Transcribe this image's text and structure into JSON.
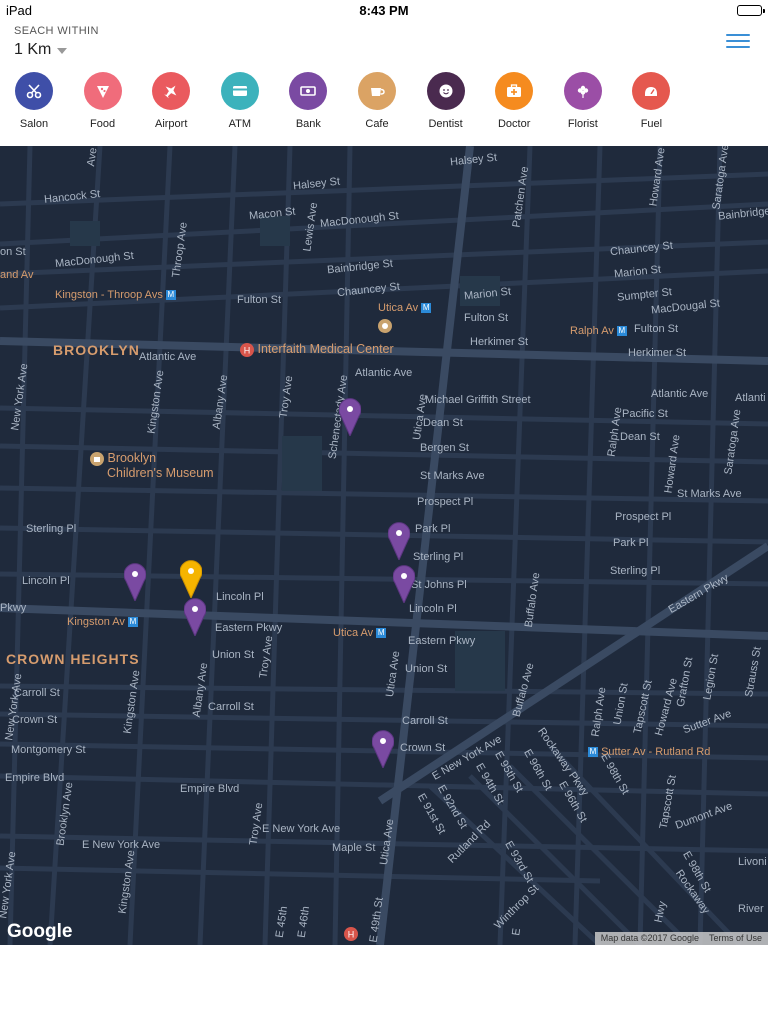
{
  "status_bar": {
    "carrier": "iPad",
    "time": "8:43 PM"
  },
  "search": {
    "label": "SEACH WITHIN",
    "radius": "1 Km"
  },
  "categories": [
    {
      "label": "Salon",
      "color": "#3f4fa8",
      "icon": "scissors-icon"
    },
    {
      "label": "Food",
      "color": "#f06c7b",
      "icon": "pizza-icon"
    },
    {
      "label": "Airport",
      "color": "#ea5a5e",
      "icon": "airplane-icon"
    },
    {
      "label": "ATM",
      "color": "#3cb2bc",
      "icon": "card-icon"
    },
    {
      "label": "Bank",
      "color": "#7a4aa2",
      "icon": "money-icon"
    },
    {
      "label": "Cafe",
      "color": "#dba364",
      "icon": "coffee-icon"
    },
    {
      "label": "Dentist",
      "color": "#4a2a4f",
      "icon": "tooth-icon"
    },
    {
      "label": "Doctor",
      "color": "#f58b1f",
      "icon": "medical-kit-icon"
    },
    {
      "label": "Florist",
      "color": "#9b4ea6",
      "icon": "flower-icon"
    },
    {
      "label": "Fuel",
      "color": "#e5584e",
      "icon": "fuel-icon"
    }
  ],
  "map": {
    "labels": {
      "brooklyn": "BROOKLYN",
      "crown_heights": "CROWN HEIGHTS",
      "interfaith": "Interfaith Medical Center",
      "museum_1": "Brooklyn",
      "museum_2": "Children's Museum",
      "kingston_throop": "Kingston - Throop Avs",
      "utica_av_top": "Utica Av",
      "ralph_av": "Ralph Av",
      "kingston_av": "Kingston Av",
      "utica_av_bottom": "Utica Av",
      "sutter_rutland": "Sutter Av - Rutland Rd",
      "halsey_st_1": "Halsey St",
      "halsey_st_2": "Halsey St",
      "hancock_st": "Hancock St",
      "macon_st": "Macon St",
      "macdonough_st_1": "MacDonough St",
      "macdonough_st_2": "MacDonough St",
      "macdougal_st": "MacDougal St",
      "bainbridge_st_1": "Bainbridge St",
      "bainbridge_st_2": "Bainbridge",
      "chauncey_st_1": "Chauncey St",
      "chauncey_st_2": "Chauncey St",
      "marion_st_1": "Marion St",
      "marion_st_2": "Marion St",
      "sumpter_st": "Sumpter St",
      "fulton_st_1": "Fulton St",
      "fulton_st_2": "Fulton St",
      "fulton_st_3": "Fulton St",
      "herkimer_st_1": "Herkimer St",
      "herkimer_st_2": "Herkimer St",
      "atlantic_ave_1": "Atlantic Ave",
      "atlantic_ave_2": "Atlantic Ave",
      "atlantic_ave_3": "Atlantic Ave",
      "atlantic_trunc": "Atlanti",
      "michael_griffith": "Michael Griffith Street",
      "pacific_st": "Pacific St",
      "dean_st_1": "Dean St",
      "dean_st_2": "Dean St",
      "bergen_st": "Bergen St",
      "st_marks_ave_1": "St Marks Ave",
      "st_marks_ave_2": "St Marks Ave",
      "prospect_pl_1": "Prospect Pl",
      "prospect_pl_2": "Prospect Pl",
      "park_pl_1": "Park Pl",
      "park_pl_2": "Park Pl",
      "sterling_pl_1": "Sterling Pl",
      "sterling_pl_2": "Sterling Pl",
      "sterling_pl_3": "Sterling Pl",
      "st_johns_pl": "St Johns Pl",
      "lincoln_pl_1": "Lincoln Pl",
      "lincoln_pl_2": "Lincoln Pl",
      "lincoln_pl_3": "Lincoln Pl",
      "eastern_pkwy_1": "Eastern Pkwy",
      "eastern_pkwy_2": "Eastern Pkwy",
      "eastern_pkwy_3": "Eastern Pkwy",
      "pkwy_trunc": "Pkwy",
      "union_st_1": "Union St",
      "union_st_2": "Union St",
      "carroll_st_1": "Carroll St",
      "carroll_st_2": "Carroll St",
      "carroll_st_3": "Carroll St",
      "crown_st_1": "Crown St",
      "crown_st_2": "Crown St",
      "montgomery_st": "Montgomery St",
      "empire_blvd_1": "Empire Blvd",
      "empire_blvd_2": "Empire Blvd",
      "e_new_york_ave_1": "E New York Ave",
      "e_new_york_ave_2": "E New York Ave",
      "e_new_york_ave_3": "E New York Ave",
      "maple_st": "Maple St",
      "sutter_ave": "Sutter Ave",
      "dumont_ave": "Dumont Ave",
      "livonia": "Livoni",
      "river": "River",
      "new_york_ave_1": "New York Ave",
      "new_york_ave_2": "New York Ave",
      "new_york_ave_3": "New York Ave",
      "kingston_ave_1": "Kingston Ave",
      "kingston_ave_2": "Kingston Ave",
      "kingston_ave_3": "Kingston Ave",
      "albany_ave_1": "Albany Ave",
      "albany_ave_2": "Albany Ave",
      "troy_ave_1": "Troy Ave",
      "troy_ave_2": "Troy Ave",
      "troy_ave_3": "Troy Ave",
      "schenectady_ave": "Schenectady Ave",
      "utica_ave_1": "Utica Ave",
      "utica_ave_2": "Utica Ave",
      "utica_ave_3": "Utica Ave",
      "ralph_ave_1": "Ralph Ave",
      "ralph_ave_2": "Ralph Ave",
      "howard_ave_1": "Howard Ave",
      "howard_ave_2": "Howard Ave",
      "howard_ave_3": "Howard Ave",
      "saratoga_ave_1": "Saratoga Ave",
      "saratoga_ave_2": "Saratoga Ave",
      "buffalo_ave_1": "Buffalo Ave",
      "buffalo_ave_2": "Buffalo Ave",
      "rockaway_pkwy_1": "Rockaway Pkwy",
      "rockaway_pkwy_2": "Rockaway",
      "lewis_ave": "Lewis Ave",
      "throop_ave": "Throop Ave",
      "patchen_ave": "Patchen Ave",
      "brooklyn_ave": "Brooklyn Ave",
      "grafton_st": "Grafton St",
      "legion_st": "Legion St",
      "strauss_st": "Strauss St",
      "union_st_v": "Union St",
      "tapscott_st_1": "Tapscott St",
      "tapscott_st_2": "Tapscott St",
      "rutland_rd": "Rutland Rd",
      "winthrop_st": "Winthrop St",
      "e_91st_st": "E 91st St",
      "e_92nd_st": "E 92nd St",
      "e_93rd_st": "E 93rd St",
      "e_94th_st": "E 94th St",
      "e_95th_st": "E 95th St",
      "e_96th_st_1": "E 96th St",
      "e_96th_st_2": "E 96th St",
      "e_98th_st_1": "E 98th St",
      "e_98th_st_2": "E 98th St",
      "e_45th": "E 45th",
      "e_46th": "E 46th",
      "e_49th_st": "E 49th St",
      "e_st_trunc": "E",
      "hwy_trunc": "Hwy",
      "ave_trunc": "Ave",
      "on_st": "on St",
      "and_av": "and Av"
    },
    "google": "Google",
    "attribution": "Map data ©2017 Google",
    "terms": "Terms of Use"
  }
}
